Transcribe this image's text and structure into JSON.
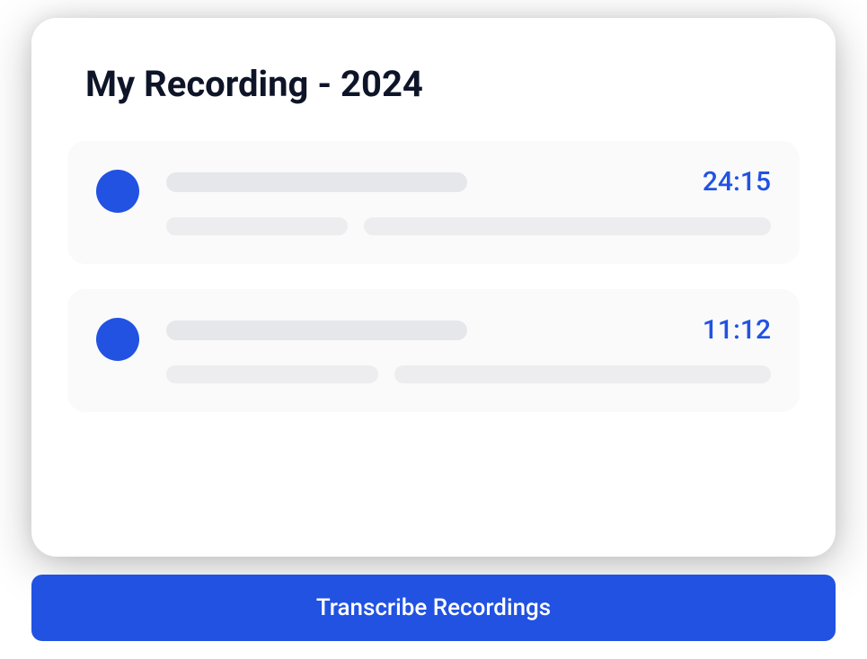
{
  "title": "My Recording - 2024",
  "recordings": [
    {
      "duration": "24:15"
    },
    {
      "duration": "11:12"
    }
  ],
  "actions": {
    "transcribe_label": "Transcribe Recordings"
  },
  "colors": {
    "accent": "#2152e2"
  }
}
